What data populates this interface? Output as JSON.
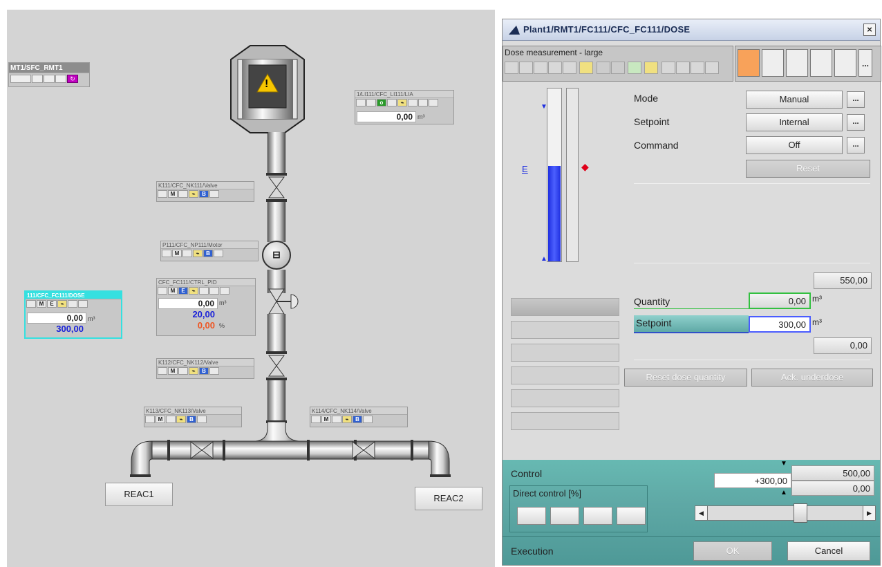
{
  "plant": {
    "sfc_block": {
      "title": "MT1/SFC_RMT1"
    },
    "tank_fp": {
      "title": "1/LI111/CFC_LI111/LIA",
      "value": "0,00",
      "unit": "m³"
    },
    "valve1_fp": {
      "title": "K111/CFC_NK111/Valve",
      "icon_m": "M",
      "icon_b": "B"
    },
    "motor_fp": {
      "title": "P111/CFC_NP111/Motor",
      "icon_m": "M",
      "icon_b": "B"
    },
    "pid_fp": {
      "title": "CFC_FC111/CTRL_PID",
      "icon_m": "M",
      "icon_e": "E",
      "pv": "0,00",
      "pv_unit": "m³",
      "sp": "20,00",
      "out": "0,00",
      "out_unit": "%"
    },
    "dose_fp": {
      "title": "111/CFC_FC111/DOSE",
      "icon_m": "M",
      "icon_e": "E",
      "value": "0,00",
      "unit": "m³",
      "setpoint": "300,00"
    },
    "valve2_fp": {
      "title": "K112/CFC_NK112/Valve",
      "icon_m": "M",
      "icon_b": "B"
    },
    "valve3_fp": {
      "title": "K113/CFC_NK113/Valve",
      "icon_m": "M",
      "icon_b": "B"
    },
    "valve4_fp": {
      "title": "K114/CFC_NK114/Valve",
      "icon_m": "M",
      "icon_b": "B"
    },
    "reac1": "REAC1",
    "reac2": "REAC2",
    "warning_glyph": "!",
    "motor_glyph": "⊟"
  },
  "faceplate": {
    "title": "Plant1/RMT1/FC111/CFC_FC111/DOSE",
    "close_glyph": "×",
    "view_name": "Dose measurement - large",
    "bar_marker": "E",
    "bar_fill_fraction": 0.55,
    "mode_label": "Mode",
    "mode_value": "Manual",
    "setpoint_src_label": "Setpoint",
    "setpoint_src_value": "Internal",
    "command_label": "Command",
    "command_value": "Off",
    "dots": "...",
    "reset_label": "Reset",
    "top_value": "550,00",
    "quantity_label": "Quantity",
    "quantity_value": "0,00",
    "quantity_unit": "m³",
    "setpoint_label": "Setpoint",
    "setpoint_value": "300,00",
    "setpoint_unit": "m³",
    "low_value": "0,00",
    "reset_dose_label": "Reset dose quantity",
    "ack_underdose_label": "Ack. underdose",
    "control_label": "Control",
    "control_high": "500,00",
    "control_value": "+300,00",
    "control_low": "0,00",
    "direct_control_label": "Direct control [%]",
    "execution_label": "Execution",
    "ok_label": "OK",
    "cancel_label": "Cancel",
    "slider_fraction": 0.6,
    "accent_teal": "#5fa9a6"
  }
}
